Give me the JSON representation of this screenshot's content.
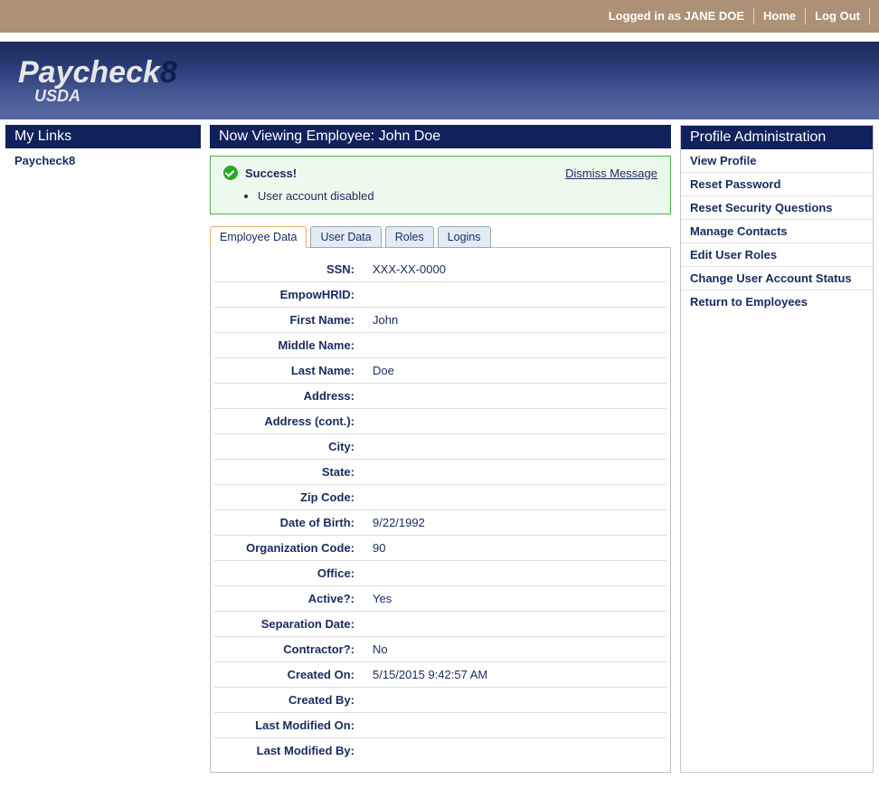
{
  "topbar": {
    "loggedin": "Logged in as JANE DOE",
    "home": "Home",
    "logout": "Log Out"
  },
  "banner": {
    "logo_text": "Paycheck",
    "logo_eight": "8",
    "usda": "USDA"
  },
  "left": {
    "title": "My Links",
    "items": [
      "Paycheck8"
    ]
  },
  "right": {
    "title": "Profile Administration",
    "items": [
      "View Profile",
      "Reset Password",
      "Reset Security Questions",
      "Manage Contacts",
      "Edit User Roles",
      "Change User Account Status",
      "Return to Employees"
    ]
  },
  "main": {
    "title": "Now Viewing Employee: John Doe",
    "success": {
      "label": "Success!",
      "message": "User account disabled",
      "dismiss": "Dismiss Message"
    },
    "tabs": [
      "Employee Data",
      "User Data",
      "Roles",
      "Logins"
    ],
    "fields": [
      {
        "label": "SSN:",
        "value": "XXX-XX-0000"
      },
      {
        "label": "EmpowHRID:",
        "value": ""
      },
      {
        "label": "First Name:",
        "value": "John"
      },
      {
        "label": "Middle Name:",
        "value": ""
      },
      {
        "label": "Last Name:",
        "value": "Doe"
      },
      {
        "label": "Address:",
        "value": ""
      },
      {
        "label": "Address (cont.):",
        "value": ""
      },
      {
        "label": "City:",
        "value": ""
      },
      {
        "label": "State:",
        "value": ""
      },
      {
        "label": "Zip Code:",
        "value": ""
      },
      {
        "label": "Date of Birth:",
        "value": "9/22/1992"
      },
      {
        "label": "Organization Code:",
        "value": "90"
      },
      {
        "label": "Office:",
        "value": ""
      },
      {
        "label": "Active?:",
        "value": "Yes"
      },
      {
        "label": "Separation Date:",
        "value": ""
      },
      {
        "label": "Contractor?:",
        "value": "No"
      },
      {
        "label": "Created On:",
        "value": "5/15/2015 9:42:57 AM"
      },
      {
        "label": "Created By:",
        "value": ""
      },
      {
        "label": "Last Modified On:",
        "value": ""
      },
      {
        "label": "Last Modified By:",
        "value": ""
      }
    ]
  }
}
